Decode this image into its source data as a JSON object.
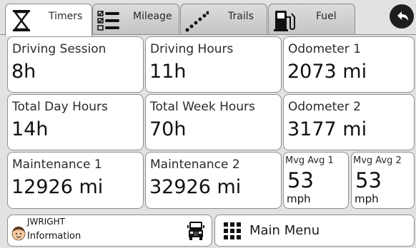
{
  "tabs": [
    {
      "label": "Timers",
      "icon": "hourglass-icon",
      "active": true
    },
    {
      "label": "Mileage",
      "icon": "checklist-icon",
      "active": false
    },
    {
      "label": "Trails",
      "icon": "trail-dots-icon",
      "active": false
    },
    {
      "label": "Fuel",
      "icon": "fuel-pump-icon",
      "active": false
    }
  ],
  "back_button": {
    "icon": "back-arrow-icon"
  },
  "cards": {
    "driving_session": {
      "label": "Driving Session",
      "value": "8h"
    },
    "driving_hours": {
      "label": "Driving Hours",
      "value": "11h"
    },
    "odometer_1": {
      "label": "Odometer 1",
      "value": "2073 mi"
    },
    "total_day_hours": {
      "label": "Total Day Hours",
      "value": "14h"
    },
    "total_week_hours": {
      "label": "Total Week Hours",
      "value": "70h"
    },
    "odometer_2": {
      "label": "Odometer 2",
      "value": "3177 mi"
    },
    "maintenance_1": {
      "label": "Maintenance 1",
      "value": "12926 mi"
    },
    "maintenance_2": {
      "label": "Maintenance 2",
      "value": "32926 mi"
    },
    "mvg_avg_1": {
      "label": "Mvg Avg 1",
      "value": "53",
      "unit": "mph"
    },
    "mvg_avg_2": {
      "label": "Mvg Avg 2",
      "value": "53",
      "unit": "mph"
    }
  },
  "user": {
    "name": "JWRIGHT",
    "subtitle": "Information",
    "avatar_icon": "driver-avatar-icon",
    "vehicle_icon": "truck-icon"
  },
  "main_menu": {
    "label": "Main Menu",
    "icon": "grid-menu-icon"
  },
  "colors": {
    "card_bg": "#ffffff",
    "page_bg": "#e2e2e2",
    "border": "#8e8e8e",
    "text": "#1a1a1a",
    "back_button": "#1e1e1e"
  }
}
